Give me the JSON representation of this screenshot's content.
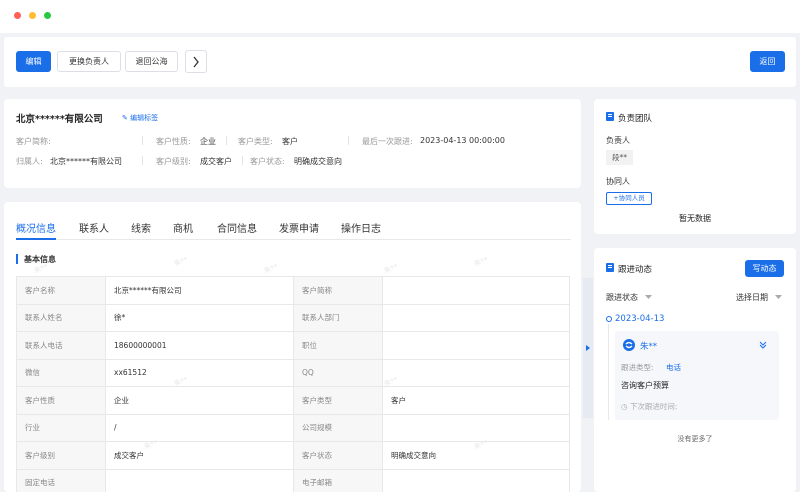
{
  "colors": {
    "primary": "#1a6ee8",
    "red_dot": "#ff5f57",
    "yellow_dot": "#febc2e",
    "green_dot": "#28c840"
  },
  "toolbar": {
    "edit": "编辑",
    "change_owner": "更换负责人",
    "return_pool": "退回公海",
    "more_icon": "chevron-right",
    "back": "返回"
  },
  "customer": {
    "name": "北京******有限公司",
    "edit_tags": "编辑标签",
    "short_name_label": "客户简称:",
    "nature_label": "客户性质:",
    "nature": "企业",
    "type_label": "客户类型:",
    "type": "客户",
    "last_follow_label": "最后一次跟进:",
    "last_follow": "2023-04-13 00:00:00",
    "owner_label": "归属人:",
    "owner": "北京******有限公司",
    "level_label": "客户级别:",
    "level": "成交客户",
    "status_label": "客户状态:",
    "status": "明确成交意向"
  },
  "tabs": [
    "概况信息",
    "联系人",
    "线索",
    "商机",
    "合同信息",
    "发票申请",
    "操作日志"
  ],
  "section_title": "基本信息",
  "watermark": "朱**",
  "table": [
    [
      "客户名称",
      "北京******有限公司",
      "客户简称",
      ""
    ],
    [
      "联系人姓名",
      "徐*",
      "联系人部门",
      ""
    ],
    [
      "联系人电话",
      "18600000001",
      "职位",
      ""
    ],
    [
      "微信",
      "xx61512",
      "QQ",
      ""
    ],
    [
      "客户性质",
      "企业",
      "客户类型",
      "客户"
    ],
    [
      "行业",
      "/",
      "公司规模",
      ""
    ],
    [
      "客户级别",
      "成交客户",
      "客户状态",
      "明确成交意向"
    ],
    [
      "固定电话",
      "",
      "电子邮箱",
      ""
    ]
  ],
  "team": {
    "title": "负责团队",
    "owner_label": "负责人",
    "owner": "段**",
    "collab_label": "协同人",
    "add_collab": "+协同人员",
    "empty": "暂无数据"
  },
  "follow": {
    "title": "跟进动态",
    "write": "写动态",
    "status_filter": "跟进状态",
    "date_filter": "选择日期",
    "date": "2023-04-13",
    "user": "朱**",
    "type_label": "跟进类型:",
    "type": "电话",
    "content": "咨询客户预算",
    "next_label": "下次跟进时间:",
    "no_more": "没有更多了"
  }
}
